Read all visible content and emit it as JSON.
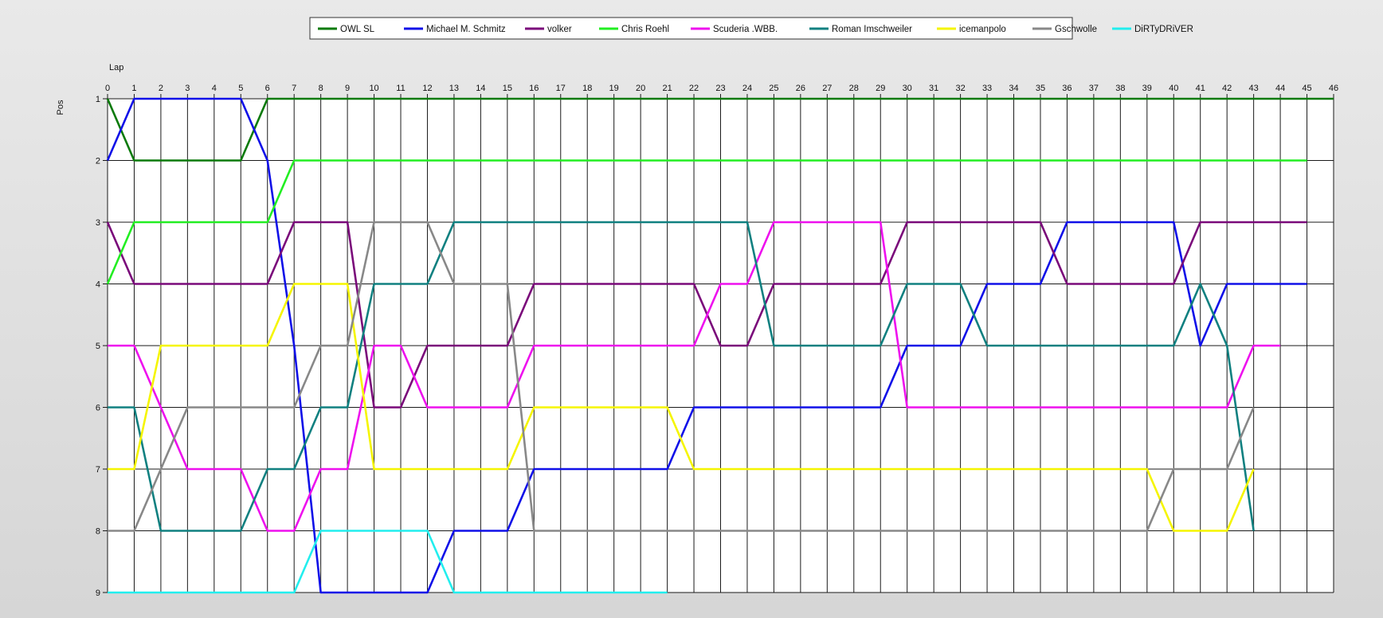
{
  "chart_data": {
    "type": "line",
    "title": "",
    "xlabel": "Lap",
    "ylabel": "Pos",
    "xlim": [
      0,
      46
    ],
    "ylim": [
      1,
      9
    ],
    "y_inverted": true,
    "grid": true,
    "legend_position": "top-center",
    "x_ticks": [
      "0",
      "1",
      "2",
      "3",
      "4",
      "5",
      "6",
      "7",
      "8",
      "9",
      "10",
      "11",
      "12",
      "13",
      "14",
      "15",
      "16",
      "17",
      "18",
      "19",
      "20",
      "21",
      "22",
      "23",
      "24",
      "25",
      "26",
      "27",
      "28",
      "29",
      "30",
      "31",
      "32",
      "33",
      "34",
      "35",
      "36",
      "37",
      "38",
      "39",
      "40",
      "41",
      "42",
      "43",
      "44",
      "45",
      "46"
    ],
    "y_ticks": [
      "1",
      "2",
      "3",
      "4",
      "5",
      "6",
      "7",
      "8",
      "9"
    ],
    "series": [
      {
        "name": "OWL SL",
        "color": "#0a7a0a",
        "values": [
          1,
          2,
          2,
          2,
          2,
          2,
          1,
          1,
          1,
          1,
          1,
          1,
          1,
          1,
          1,
          1,
          1,
          1,
          1,
          1,
          1,
          1,
          1,
          1,
          1,
          1,
          1,
          1,
          1,
          1,
          1,
          1,
          1,
          1,
          1,
          1,
          1,
          1,
          1,
          1,
          1,
          1,
          1,
          1,
          1,
          1,
          1
        ]
      },
      {
        "name": "Michael M. Schmitz",
        "color": "#1010e8",
        "values": [
          2,
          1,
          1,
          1,
          1,
          1,
          2,
          5,
          9,
          9,
          9,
          9,
          9,
          8,
          8,
          8,
          7,
          7,
          7,
          7,
          7,
          7,
          6,
          6,
          6,
          6,
          6,
          6,
          6,
          6,
          5,
          5,
          5,
          4,
          4,
          4,
          3,
          3,
          3,
          3,
          3,
          5,
          4,
          4,
          4,
          4
        ]
      },
      {
        "name": "volker",
        "color": "#7a0a7a",
        "values": [
          3,
          4,
          4,
          4,
          4,
          4,
          4,
          3,
          3,
          3,
          6,
          6,
          5,
          5,
          5,
          5,
          4,
          4,
          4,
          4,
          4,
          4,
          4,
          5,
          5,
          4,
          4,
          4,
          4,
          4,
          3,
          3,
          3,
          3,
          3,
          3,
          4,
          4,
          4,
          4,
          4,
          3,
          3,
          3,
          3,
          3
        ]
      },
      {
        "name": "Chris Roehl",
        "color": "#22ee22",
        "values": [
          4,
          3,
          3,
          3,
          3,
          3,
          3,
          2,
          2,
          2,
          2,
          2,
          2,
          2,
          2,
          2,
          2,
          2,
          2,
          2,
          2,
          2,
          2,
          2,
          2,
          2,
          2,
          2,
          2,
          2,
          2,
          2,
          2,
          2,
          2,
          2,
          2,
          2,
          2,
          2,
          2,
          2,
          2,
          2,
          2,
          2
        ]
      },
      {
        "name": "Scuderia .WBB.",
        "color": "#ee10ee",
        "values": [
          5,
          5,
          6,
          7,
          7,
          7,
          8,
          8,
          7,
          7,
          5,
          5,
          6,
          6,
          6,
          6,
          5,
          5,
          5,
          5,
          5,
          5,
          5,
          4,
          4,
          3,
          3,
          3,
          3,
          3,
          6,
          6,
          6,
          6,
          6,
          6,
          6,
          6,
          6,
          6,
          6,
          6,
          6,
          5,
          5
        ]
      },
      {
        "name": "Roman Imschweiler",
        "color": "#108080",
        "values": [
          6,
          6,
          8,
          8,
          8,
          8,
          7,
          7,
          6,
          6,
          4,
          4,
          4,
          3,
          3,
          3,
          3,
          3,
          3,
          3,
          3,
          3,
          3,
          3,
          3,
          5,
          5,
          5,
          5,
          5,
          4,
          4,
          4,
          5,
          5,
          5,
          5,
          5,
          5,
          5,
          5,
          4,
          5,
          8
        ]
      },
      {
        "name": "icemanpolo",
        "color": "#f5f500",
        "values": [
          7,
          7,
          5,
          5,
          5,
          5,
          5,
          4,
          4,
          4,
          7,
          7,
          7,
          7,
          7,
          7,
          6,
          6,
          6,
          6,
          6,
          6,
          7,
          7,
          7,
          7,
          7,
          7,
          7,
          7,
          7,
          7,
          7,
          7,
          7,
          7,
          7,
          7,
          7,
          7,
          8,
          8,
          8,
          7
        ]
      },
      {
        "name": "Gschwolle",
        "color": "#888888",
        "values": [
          8,
          8,
          7,
          6,
          6,
          6,
          6,
          6,
          5,
          5,
          3,
          3,
          3,
          4,
          4,
          4,
          8,
          8,
          8,
          8,
          8,
          8,
          8,
          8,
          8,
          8,
          8,
          8,
          8,
          8,
          8,
          8,
          8,
          8,
          8,
          8,
          8,
          8,
          8,
          8,
          7,
          7,
          7,
          6
        ]
      },
      {
        "name": "DiRTyDRiVER",
        "color": "#22eeee",
        "values": [
          9,
          9,
          9,
          9,
          9,
          9,
          9,
          9,
          8,
          8,
          8,
          8,
          8,
          9,
          9,
          9,
          9,
          9,
          9,
          9,
          9,
          9
        ]
      }
    ]
  }
}
